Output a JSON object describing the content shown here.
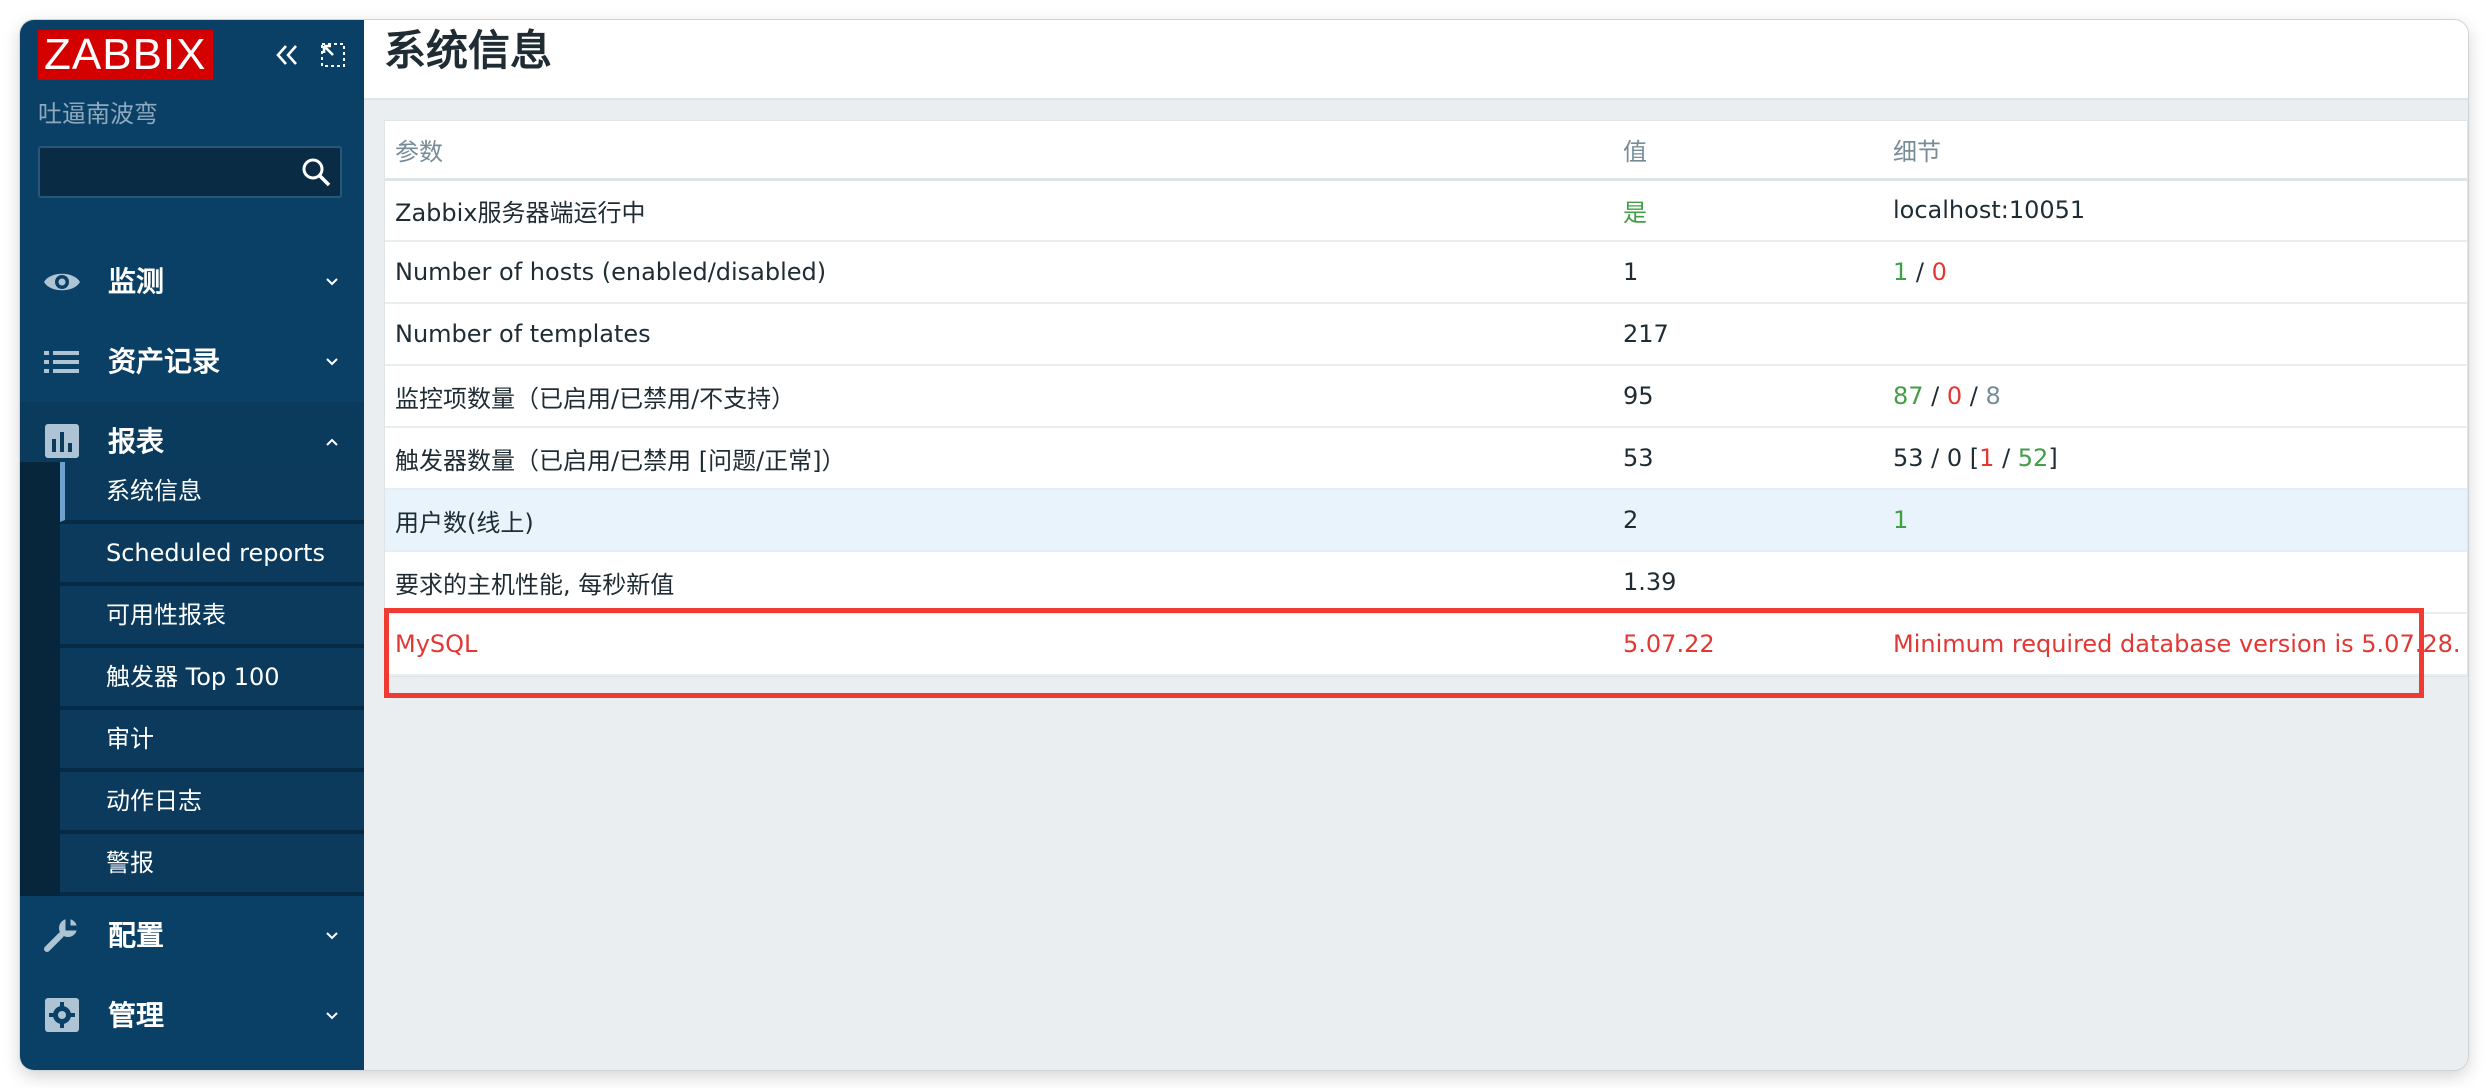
{
  "app": {
    "logo": "ZABBIX",
    "org": "吐逼南波弯"
  },
  "search": {
    "value": "",
    "placeholder": ""
  },
  "nav": [
    {
      "id": "monitoring",
      "label": "监测",
      "icon": "eye-icon",
      "expanded": false
    },
    {
      "id": "inventory",
      "label": "资产记录",
      "icon": "list-icon",
      "expanded": false
    },
    {
      "id": "reports",
      "label": "报表",
      "icon": "bar-chart-icon",
      "expanded": true
    },
    {
      "id": "configuration",
      "label": "配置",
      "icon": "wrench-icon",
      "expanded": false
    },
    {
      "id": "administration",
      "label": "管理",
      "icon": "gear-icon",
      "expanded": false
    }
  ],
  "submenu": [
    {
      "label": "系统信息",
      "active": true
    },
    {
      "label": "Scheduled reports"
    },
    {
      "label": "可用性报表"
    },
    {
      "label": "触发器 Top 100"
    },
    {
      "label": "审计"
    },
    {
      "label": "动作日志"
    },
    {
      "label": "警报"
    }
  ],
  "page": {
    "title": "系统信息"
  },
  "table": {
    "headers": [
      "参数",
      "值",
      "细节"
    ],
    "rows": [
      {
        "param": "Zabbix服务器端运行中",
        "value": "是",
        "details": "localhost:10051"
      },
      {
        "param": "Number of hosts (enabled/disabled)",
        "value": "1",
        "d1": "1",
        "sep1": " / ",
        "d2": "0"
      },
      {
        "param": "Number of templates",
        "value": "217",
        "details": ""
      },
      {
        "param": "监控项数量（已启用/已禁用/不支持）",
        "value": "95",
        "d1": "87",
        "sep1": " / ",
        "d2": "0",
        "sep2": " / ",
        "d3": "8"
      },
      {
        "param": "触发器数量（已启用/已禁用 [问题/正常]）",
        "value": "53",
        "prefix": "53 / 0 [",
        "d1": "1",
        "sep1": " / ",
        "d2": "52",
        "suffix": "]"
      },
      {
        "param": "用户数(线上)",
        "value": "2",
        "details": "1"
      },
      {
        "param": "要求的主机性能, 每秒新值",
        "value": "1.39",
        "details": ""
      },
      {
        "param": "MySQL",
        "value": "5.07.22",
        "details": "Minimum required database version is 5.07.28."
      }
    ]
  },
  "colors": {
    "sidebar": "#0b4066",
    "ok": "#429e47",
    "error": "#e33734",
    "muted": "#768d99",
    "annotation": "#f03a34"
  }
}
